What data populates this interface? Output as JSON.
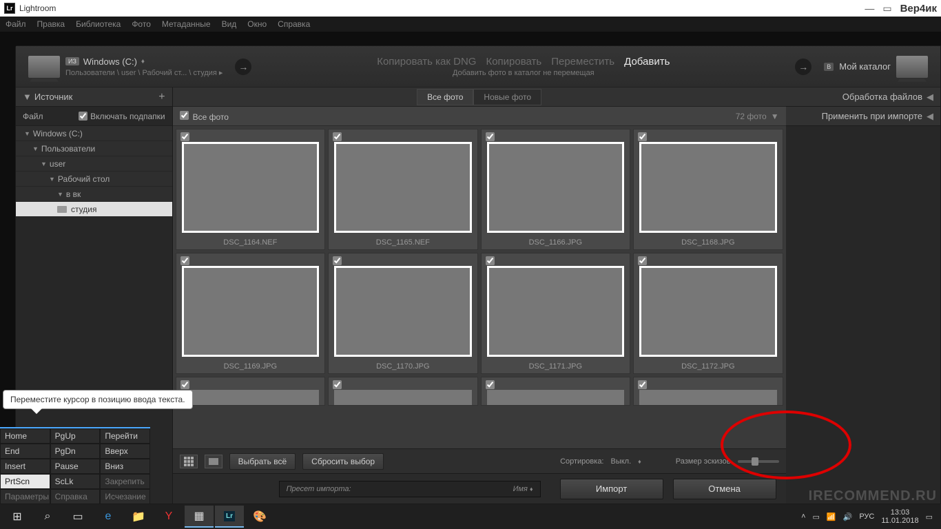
{
  "titlebar": {
    "app": "Lightroom",
    "user": "Вер4ик"
  },
  "menu": [
    "Файл",
    "Правка",
    "Библиотека",
    "Фото",
    "Метаданные",
    "Вид",
    "Окно",
    "Справка"
  ],
  "header": {
    "src_badge": "ИЗ",
    "src_drive": "Windows (C:)",
    "src_path": "Пользователи \\ user \\ Рабочий ст... \\ студия ▸",
    "modes": {
      "dng": "Копировать как DNG",
      "copy": "Копировать",
      "move": "Переместить",
      "add": "Добавить"
    },
    "mode_sub": "Добавить фото в каталог не перемещая",
    "dest_badge": "В",
    "dest_label": "Мой каталог"
  },
  "left": {
    "title": "Источник",
    "file": "Файл",
    "subfolders": "Включать подпапки",
    "tree": [
      {
        "label": "Windows (C:)",
        "depth": 0
      },
      {
        "label": "Пользователи",
        "depth": 1
      },
      {
        "label": "user",
        "depth": 2
      },
      {
        "label": "Рабочий стол",
        "depth": 3
      },
      {
        "label": "в вк",
        "depth": 4
      },
      {
        "label": "студия",
        "depth": 4,
        "sel": true
      }
    ]
  },
  "tabs": {
    "all": "Все фото",
    "new": "Новые фото"
  },
  "select": {
    "all": "Все фото",
    "count": "72 фото"
  },
  "thumbs": [
    {
      "name": "DSC_1164.NEF",
      "c": "ph1"
    },
    {
      "name": "DSC_1165.NEF",
      "c": "ph2"
    },
    {
      "name": "DSC_1166.JPG",
      "c": "ph3"
    },
    {
      "name": "DSC_1168.JPG",
      "c": "ph4"
    },
    {
      "name": "DSC_1169.JPG",
      "c": "ph5"
    },
    {
      "name": "DSC_1170.JPG",
      "c": "ph6"
    },
    {
      "name": "DSC_1171.JPG",
      "c": "ph7"
    },
    {
      "name": "DSC_1172.JPG",
      "c": "ph8"
    }
  ],
  "toolbar": {
    "select_all": "Выбрать всё",
    "deselect": "Сбросить выбор",
    "sort": "Сортировка:",
    "sort_val": "Выкл.",
    "size": "Размер эскизов"
  },
  "bottom": {
    "preset": "Пресет импорта:",
    "preset_val": "Имя",
    "import": "Импорт",
    "cancel": "Отмена"
  },
  "right": {
    "process": "Обработка файлов",
    "apply": "Применить при импорте"
  },
  "tooltip": "Переместите курсор в позицию ввода текста.",
  "osk": [
    [
      "Home",
      "PgUp",
      "Перейти"
    ],
    [
      "End",
      "PgDn",
      "Вверх"
    ],
    [
      "Insert",
      "Pause",
      "Вниз"
    ],
    [
      "PrtScn",
      "ScLk",
      "Закрепить"
    ],
    [
      "Параметры",
      "Справка",
      "Исчезание"
    ]
  ],
  "tray": {
    "lang": "РУС",
    "time": "13:03",
    "date": "11.01.2018"
  },
  "watermark": "IRECOMMEND.RU"
}
